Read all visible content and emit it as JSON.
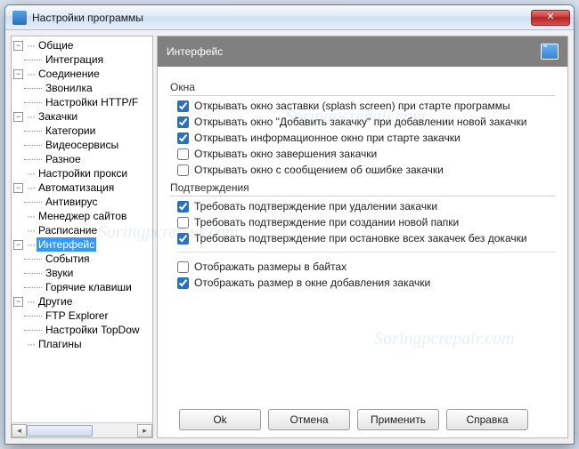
{
  "window": {
    "title": "Настройки программы"
  },
  "tree": {
    "groups": [
      {
        "label": "Общие",
        "children": [
          "Интеграция"
        ]
      },
      {
        "label": "Соединение",
        "children": [
          "Звонилка",
          "Настройки HTTP/F"
        ]
      },
      {
        "label": "Закачки",
        "children": [
          "Категории",
          "Видеосервисы",
          "Разное"
        ]
      },
      {
        "label": "Настройки прокси",
        "children": []
      },
      {
        "label": "Автоматизация",
        "children": [
          "Антивирус"
        ]
      },
      {
        "label": "Менеджер сайтов",
        "children": []
      },
      {
        "label": "Расписание",
        "children": []
      },
      {
        "label": "Интерфейс",
        "children": [
          "События",
          "Звуки",
          "Горячие клавиши"
        ],
        "selected": true
      },
      {
        "label": "Другие",
        "children": [
          "FTP Explorer",
          "Настройки TopDow"
        ]
      },
      {
        "label": "Плагины",
        "children": []
      }
    ]
  },
  "panel": {
    "title": "Интерфейс",
    "groups": [
      {
        "title": "Окна",
        "options": [
          {
            "label": "Открывать окно заставки (splash screen) при старте программы",
            "checked": true
          },
          {
            "label": "Открывать окно \"Добавить закачку\" при добавлении новой закачки",
            "checked": true
          },
          {
            "label": "Открывать информационное окно при старте закачки",
            "checked": true
          },
          {
            "label": "Открывать окно завершения закачки",
            "checked": false
          },
          {
            "label": "Открывать окно с сообщением об ошибке закачки",
            "checked": false
          }
        ]
      },
      {
        "title": "Подтверждения",
        "options": [
          {
            "label": "Требовать подтверждение при удалении закачки",
            "checked": true
          },
          {
            "label": "Требовать подтверждение при создании новой папки",
            "checked": false
          },
          {
            "label": "Требовать подтверждение при остановке всех закачек без докачки",
            "checked": true
          }
        ]
      },
      {
        "title": "",
        "options": [
          {
            "label": "Отображать размеры в байтах",
            "checked": false
          },
          {
            "label": "Отображать размер в окне добавления закачки",
            "checked": true
          }
        ]
      }
    ]
  },
  "buttons": {
    "ok": "Ok",
    "cancel": "Отмена",
    "apply": "Применить",
    "help": "Справка"
  },
  "watermark": "Soringpcrepair.com"
}
